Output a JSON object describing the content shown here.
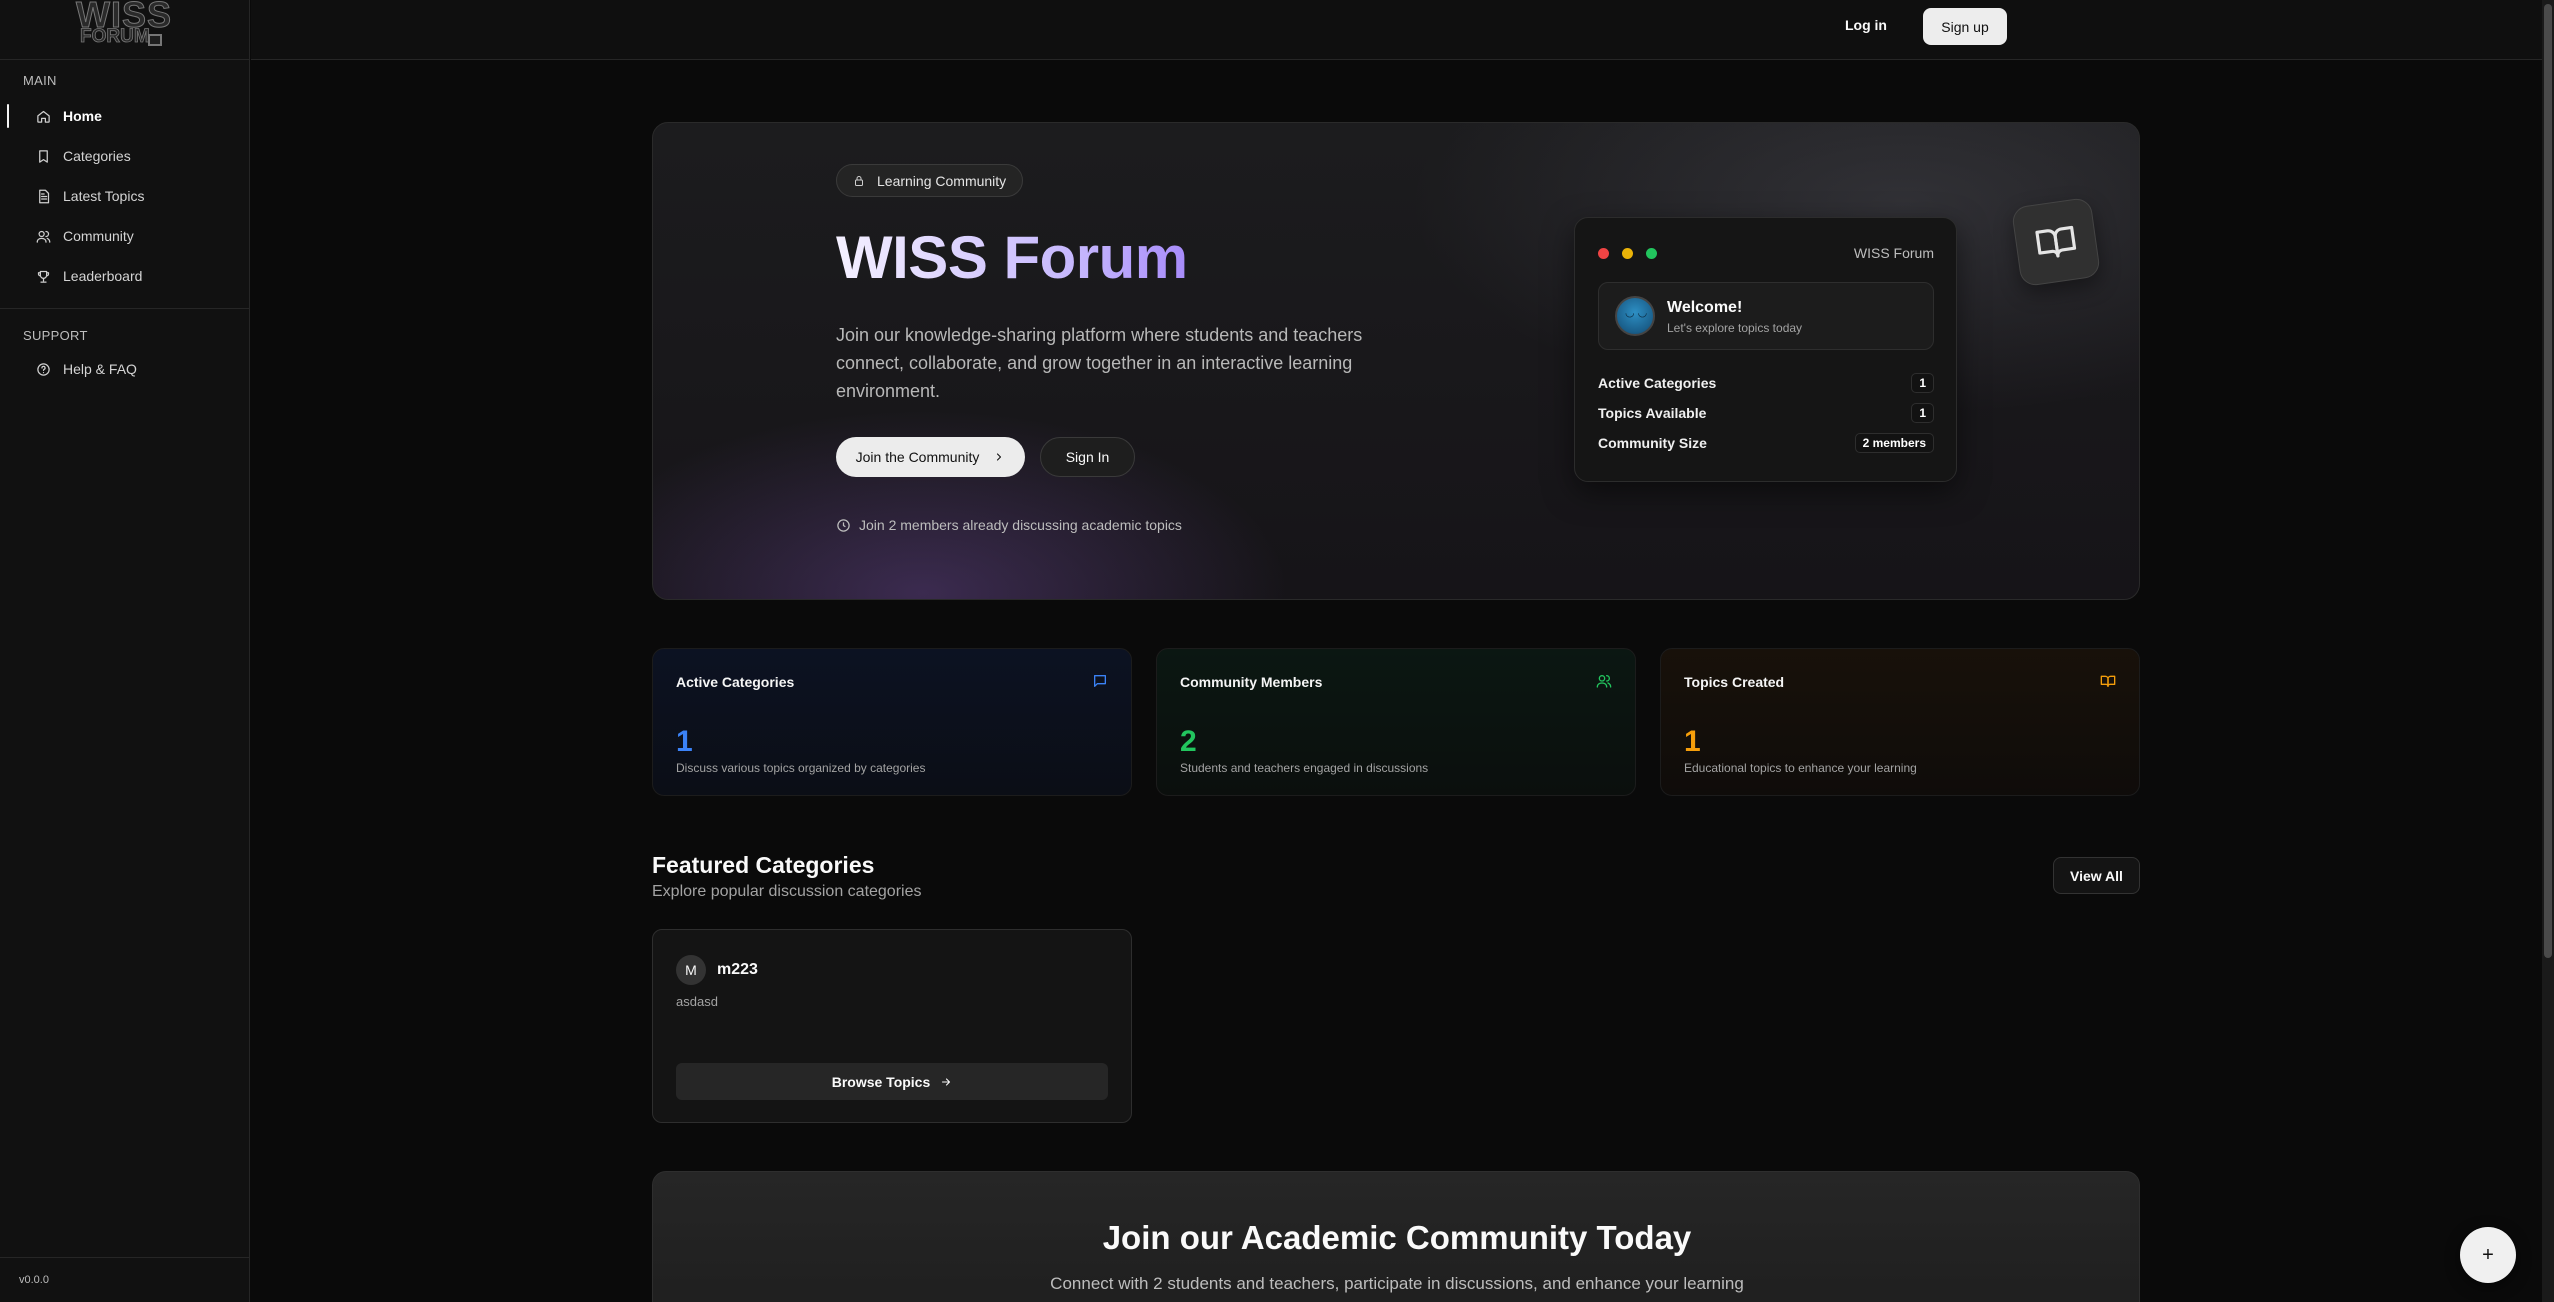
{
  "logo": {
    "line1": "WISS",
    "line2": "FORUM"
  },
  "sidebar": {
    "main_title": "MAIN",
    "main_items": [
      {
        "label": "Home",
        "icon": "home-icon"
      },
      {
        "label": "Categories",
        "icon": "bookmark-icon"
      },
      {
        "label": "Latest Topics",
        "icon": "document-icon"
      },
      {
        "label": "Community",
        "icon": "users-icon"
      },
      {
        "label": "Leaderboard",
        "icon": "trophy-icon"
      }
    ],
    "support_title": "SUPPORT",
    "support_items": [
      {
        "label": "Help & FAQ",
        "icon": "help-circle-icon"
      }
    ],
    "version": "v0.0.0"
  },
  "topbar": {
    "login": "Log in",
    "signup": "Sign up"
  },
  "hero": {
    "badge": "Learning Community",
    "title": "WISS Forum",
    "description": "Join our knowledge-sharing platform where students and teachers connect, collaborate, and grow together in an interactive learning environment.",
    "join_button": "Join the Community",
    "signin_button": "Sign In",
    "note": "Join 2 members already discussing academic topics"
  },
  "preview": {
    "brand": "WISS Forum",
    "welcome_title": "Welcome!",
    "welcome_sub": "Let's explore topics today",
    "stats": [
      {
        "label": "Active Categories",
        "value": "1"
      },
      {
        "label": "Topics Available",
        "value": "1"
      },
      {
        "label": "Community Size",
        "value": "2 members"
      }
    ]
  },
  "stat_cards": [
    {
      "title": "Active Categories",
      "value": "1",
      "desc": "Discuss various topics organized by categories",
      "color": "#3b82f6",
      "icon": "message-icon"
    },
    {
      "title": "Community Members",
      "value": "2",
      "desc": "Students and teachers engaged in discussions",
      "color": "#22c55e",
      "icon": "users-icon"
    },
    {
      "title": "Topics Created",
      "value": "1",
      "desc": "Educational topics to enhance your learning",
      "color": "#f59e0b",
      "icon": "book-icon"
    }
  ],
  "featured": {
    "title": "Featured Categories",
    "subtitle": "Explore popular discussion categories",
    "view_all": "View All",
    "categories": [
      {
        "initial": "M",
        "name": "m223",
        "description": "asdasd",
        "button": "Browse Topics"
      }
    ]
  },
  "cta": {
    "title": "Join our Academic Community Today",
    "subtitle": "Connect with 2 students and teachers, participate in discussions, and enhance your learning"
  },
  "fab": {
    "label": "+"
  }
}
